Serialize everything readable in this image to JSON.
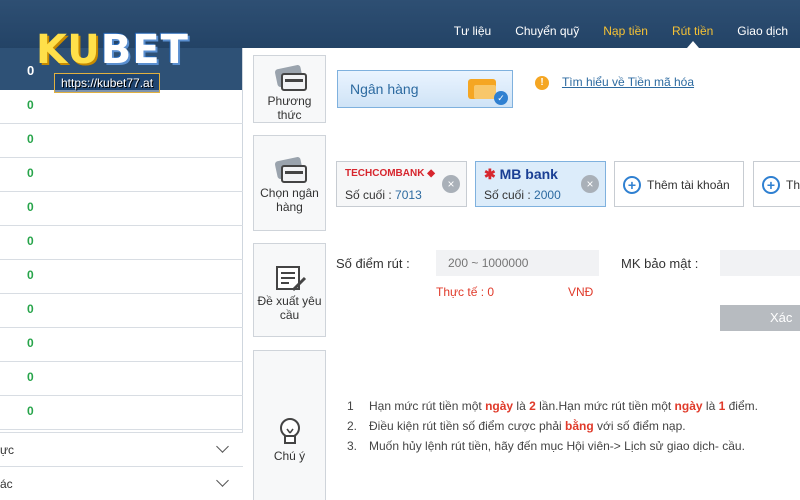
{
  "header": {
    "nav": [
      {
        "label": "Tư liệu",
        "style": "normal"
      },
      {
        "label": "Chuyển quỹ",
        "style": "normal"
      },
      {
        "label": "Nạp tiền",
        "style": "gold"
      },
      {
        "label": "Rút tiền",
        "style": "active"
      },
      {
        "label": "Giao dịch",
        "style": "normal"
      }
    ]
  },
  "logo": {
    "text_part1": "KU",
    "text_part2": "BET",
    "url": "https://kubet77.at"
  },
  "sidebar": {
    "top_value": "0",
    "rows": [
      "0",
      "0",
      "0",
      "0",
      "0",
      "0",
      "0",
      "0",
      "0",
      "0"
    ],
    "dropdowns": [
      {
        "label": "ực"
      },
      {
        "label": "ác"
      }
    ]
  },
  "main": {
    "steps": {
      "method": "Phương thức",
      "bank": "Chọn ngân hàng",
      "request": "Đề xuất yêu cầu",
      "note": "Chú ý"
    },
    "method_option": "Ngân hàng",
    "crypto_link": "Tìm hiểu về Tiền mã hóa",
    "banks": [
      {
        "name": "TECHCOMBANK",
        "last_label": "Số cuối :",
        "last_digits": "7013",
        "selected": false
      },
      {
        "name": "MB bank",
        "last_label": "Số cuối :",
        "last_digits": "2000",
        "selected": true
      }
    ],
    "add_account_label": "Thêm tài khoản",
    "add_account_label_2": "Th",
    "form": {
      "points_label": "Số điểm rút",
      "points_placeholder": "200 ~ 1000000",
      "password_label": "MK bảo mật",
      "actual_label": "Thực tế : 0",
      "currency": "VNĐ",
      "submit_label": "Xác"
    },
    "rules": [
      {
        "num": "1",
        "parts": [
          "Hạn mức rút tiền một ",
          "ngày",
          " là ",
          "2",
          " lần.Hạn mức rút tiền một ",
          "ngày",
          " là ",
          "1",
          " điểm."
        ]
      },
      {
        "num": "2.",
        "parts": [
          "Điều kiện rút tiền số điểm cược phải ",
          "bằng",
          " với số điểm nạp."
        ]
      },
      {
        "num": "3.",
        "parts": [
          "Muốn hủy lệnh rút tiền, hãy đến mục Hội viên-> Lịch sử giao dịch-",
          "",
          " cầu."
        ]
      }
    ]
  },
  "colors": {
    "header_bg": "#2e4f73",
    "nav_gold": "#f6c234",
    "accent_blue": "#2f80d1",
    "highlight_red": "#e03a2a",
    "sidebar_zero": "#27a44a"
  }
}
